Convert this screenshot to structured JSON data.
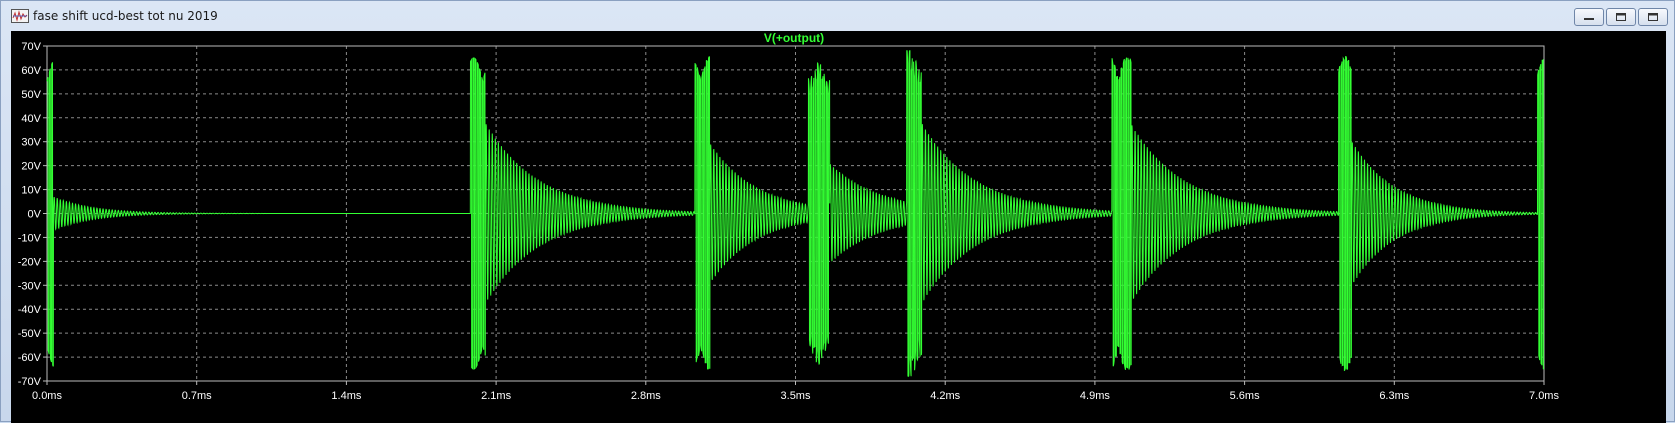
{
  "window": {
    "title": "fase shift ucd-best tot nu 2019",
    "icon": "ltspice-waveform-icon",
    "controls": [
      "minimize-icon",
      "restore-icon",
      "close-icon"
    ]
  },
  "colors": {
    "background": "#000000",
    "trace": "#33ff33",
    "grid": "#8a8a8a",
    "axis_text": "#ffffff",
    "title_text": "#33ff33"
  },
  "chart_data": {
    "type": "line",
    "title": "V(+output)",
    "xlabel": "",
    "ylabel": "",
    "xlim": [
      0,
      7.0
    ],
    "ylim": [
      -70,
      70
    ],
    "grid": true,
    "x_ticks": [
      "0.0ms",
      "0.7ms",
      "1.4ms",
      "2.1ms",
      "2.8ms",
      "3.5ms",
      "4.2ms",
      "4.9ms",
      "5.6ms",
      "6.3ms",
      "7.0ms"
    ],
    "x_tick_values": [
      0,
      0.7,
      1.4,
      2.1,
      2.8,
      3.5,
      4.2,
      4.9,
      5.6,
      6.3,
      7.0
    ],
    "y_ticks": [
      "70V",
      "60V",
      "50V",
      "40V",
      "30V",
      "20V",
      "10V",
      "0V",
      "-10V",
      "-20V",
      "-30V",
      "-40V",
      "-50V",
      "-60V",
      "-70V"
    ],
    "y_tick_values": [
      70,
      60,
      50,
      40,
      30,
      20,
      10,
      0,
      -10,
      -20,
      -30,
      -40,
      -50,
      -60,
      -70
    ],
    "series": [
      {
        "name": "V(+output)",
        "bursts": [
          {
            "start_ms": 0.0,
            "end_ms": 0.03,
            "peak_v": 65,
            "ring_v": 7,
            "decay_ms": 0.18
          },
          {
            "start_ms": 1.98,
            "end_ms": 2.05,
            "peak_v": 65,
            "ring_v": 38,
            "decay_ms": 0.25
          },
          {
            "start_ms": 3.03,
            "end_ms": 3.1,
            "peak_v": 65,
            "ring_v": 30,
            "decay_ms": 0.22
          },
          {
            "start_ms": 3.56,
            "end_ms": 3.66,
            "peak_v": 60,
            "ring_v": 20,
            "decay_ms": 0.25
          },
          {
            "start_ms": 4.02,
            "end_ms": 4.09,
            "peak_v": 65,
            "ring_v": 35,
            "decay_ms": 0.25
          },
          {
            "start_ms": 4.98,
            "end_ms": 5.07,
            "peak_v": 65,
            "ring_v": 38,
            "decay_ms": 0.25
          },
          {
            "start_ms": 6.04,
            "end_ms": 6.1,
            "peak_v": 65,
            "ring_v": 30,
            "decay_ms": 0.2
          },
          {
            "start_ms": 6.97,
            "end_ms": 7.0,
            "peak_v": 65,
            "ring_v": 40,
            "decay_ms": 0.1
          }
        ]
      }
    ]
  }
}
